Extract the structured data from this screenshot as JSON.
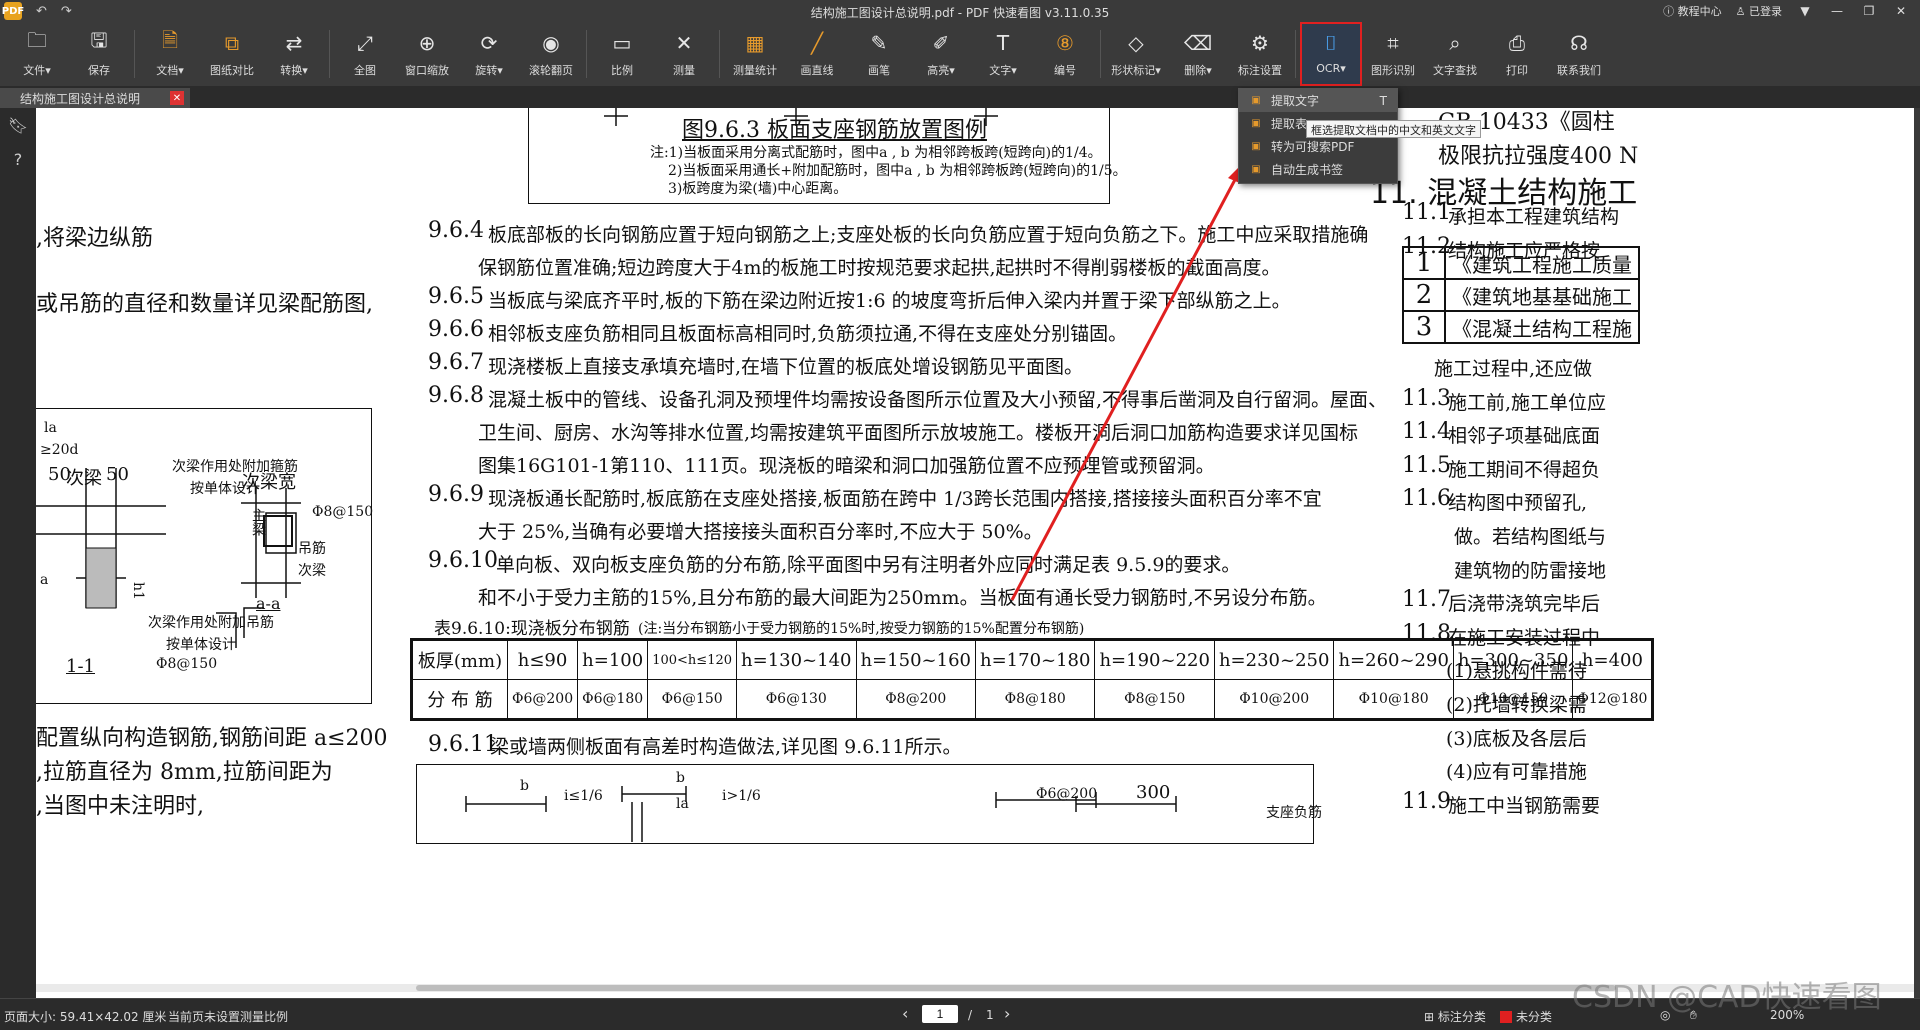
{
  "window": {
    "title": "结构施工图设计总说明.pdf - PDF 快速看图 v3.11.0.35",
    "app_logo": "PDF",
    "help_center": "教程中心",
    "login": "已登录",
    "undo_icon": "undo-icon",
    "redo_icon": "redo-icon"
  },
  "toolbar": {
    "items": [
      {
        "label": "文件▾",
        "icon": "folder-icon",
        "glyph": "🗀"
      },
      {
        "label": "保存",
        "icon": "save-icon",
        "glyph": "🖫"
      },
      {
        "label": "文档▾",
        "icon": "document-icon",
        "glyph": "🗎"
      },
      {
        "label": "图纸对比",
        "icon": "compare-icon",
        "glyph": "⧉"
      },
      {
        "label": "转换▾",
        "icon": "convert-icon",
        "glyph": "⇄"
      },
      {
        "label": "全图",
        "icon": "fit-icon",
        "glyph": "⤢"
      },
      {
        "label": "窗口缩放",
        "icon": "zoom-window-icon",
        "glyph": "⊕"
      },
      {
        "label": "旋转▾",
        "icon": "rotate-icon",
        "glyph": "⟳"
      },
      {
        "label": "滚轮翻页",
        "icon": "mouse-icon",
        "glyph": "◉"
      },
      {
        "label": "比例",
        "icon": "scale-icon",
        "glyph": "▭"
      },
      {
        "label": "测量",
        "icon": "measure-icon",
        "glyph": "✕"
      },
      {
        "label": "测量统计",
        "icon": "measure-stats-icon",
        "glyph": "▦"
      },
      {
        "label": "画直线",
        "icon": "line-icon",
        "glyph": "╱"
      },
      {
        "label": "画笔",
        "icon": "pen-icon",
        "glyph": "✎"
      },
      {
        "label": "高亮▾",
        "icon": "highlight-icon",
        "glyph": "✐"
      },
      {
        "label": "文字▾",
        "icon": "text-icon",
        "glyph": "T"
      },
      {
        "label": "编号",
        "icon": "number-icon",
        "glyph": "⑧"
      },
      {
        "label": "形状标记▾",
        "icon": "shape-mark-icon",
        "glyph": "◇"
      },
      {
        "label": "删除▾",
        "icon": "eraser-icon",
        "glyph": "⌫"
      },
      {
        "label": "标注设置",
        "icon": "annotation-settings-icon",
        "glyph": "⚙"
      },
      {
        "label": "OCR▾",
        "icon": "ocr-icon",
        "glyph": "⌷"
      },
      {
        "label": "图形识别",
        "icon": "shape-recognition-icon",
        "glyph": "⌗"
      },
      {
        "label": "文字查找",
        "icon": "search-icon",
        "glyph": "⌕"
      },
      {
        "label": "打印",
        "icon": "print-icon",
        "glyph": "⎙"
      },
      {
        "label": "联系我们",
        "icon": "headset-icon",
        "glyph": "☊"
      }
    ]
  },
  "tab": {
    "label": "结构施工图设计总说明",
    "close": "✕"
  },
  "ocr_menu": {
    "items": [
      {
        "label": "提取文字",
        "shortcut": "T"
      },
      {
        "label": "提取表",
        "shortcut": ""
      },
      {
        "label": "转为可搜索PDF",
        "shortcut": ""
      },
      {
        "label": "自动生成书签",
        "shortcut": ""
      }
    ],
    "tooltip": "框选提取文档中的中文和英文文字"
  },
  "doc": {
    "fig963_title": "图9.6.3  板面支座钢筋放置图例",
    "fig963_notes": [
      "注:1)当板面采用分离式配筋时，图中a , b 为相邻跨板跨(短跨向)的1/4。",
      "2)当板面采用通长+附加配筋时，图中a , b 为相邻跨板跨(短跨向)的1/5。",
      "3)板跨度为梁(墙)中心距离。"
    ],
    "left_col": [
      ",将梁边纵筋",
      "或吊筋的直径和数量详见梁配筋图,",
      "配置纵向构造钢筋,钢筋间距  a≤200",
      ",拉筋直径为 8mm,拉筋间距为",
      ",当图中未注明时,"
    ],
    "left_fig": {
      "la": "la",
      "ge20d": "≥20d",
      "fifty": "50",
      "ciliang": "次梁",
      "fifty2": "50",
      "note1": "次梁作用处附加箍筋",
      "note1b": "按单体设计",
      "ciliang_kuan": "次梁宽",
      "zhuliang": "主梁",
      "phi8": "Φ8@150",
      "diaojin": "吊筋",
      "ciliang2": "次梁",
      "a": "a",
      "h1": "h1",
      "note2": "次梁作用处附加吊筋",
      "note2b": "按单体设计",
      "aa": "a-a",
      "sec11": "1-1",
      "phi8b": "Φ8@150"
    },
    "paras": [
      {
        "num": "9.6.4",
        "lines": [
          "板底部板的长向钢筋应置于短向钢筋之上;支座处板的长向负筋应置于短向负筋之下。施工中应采取措施确",
          "保钢筋位置准确;短边跨度大于4m的板施工时按规范要求起拱,起拱时不得削弱楼板的截面高度。"
        ]
      },
      {
        "num": "9.6.5",
        "lines": [
          "当板底与梁底齐平时,板的下筋在梁边附近按1:6 的坡度弯折后伸入梁内并置于梁下部纵筋之上。"
        ]
      },
      {
        "num": "9.6.6",
        "lines": [
          "相邻板支座负筋相同且板面标高相同时,负筋须拉通,不得在支座处分别锚固。"
        ]
      },
      {
        "num": "9.6.7",
        "lines": [
          "现浇楼板上直接支承填充墙时,在墙下位置的板底处增设钢筋见平面图。"
        ]
      },
      {
        "num": "9.6.8",
        "lines": [
          "混凝土板中的管线、设备孔洞及预埋件均需按设备图所示位置及大小预留,不得事后凿洞及自行留洞。屋面、",
          "卫生间、厨房、水沟等排水位置,均需按建筑平面图所示放坡施工。楼板开洞后洞口加筋构造要求详见国标",
          "图集16G101-1第110、111页。现浇板的暗梁和洞口加强筋位置不应预埋管或预留洞。"
        ]
      },
      {
        "num": "9.6.9",
        "lines": [
          "现浇板通长配筋时,板底筋在支座处搭接,板面筋在跨中 1/3跨长范围内搭接,搭接接头面积百分率不宜",
          "大于 25%,当确有必要增大搭接接头面积百分率时,不应大于 50%。"
        ]
      },
      {
        "num": "9.6.10",
        "lines": [
          "单向板、双向板支座负筋的分布筋,除平面图中另有注明者外应同时满足表 9.5.9的要求。",
          "和不小于受力主筋的15%,且分布筋的最大间距为250mm。当板面有通长受力钢筋时,不另设分布筋。"
        ]
      }
    ],
    "table_title": "表9.6.10:现浇板分布钢筋",
    "table_note": "(注:当分布钢筋小于受力钢筋的15%时,按受力钢筋的15%配置分布钢筋)",
    "table_header": [
      "板厚(mm)",
      "h≤90",
      "h=100",
      "100<h≤120",
      "h=130~140",
      "h=150~160",
      "h=170~180",
      "h=190~220",
      "h=230~250",
      "h=260~290",
      "h=300~350",
      "h=400"
    ],
    "table_row": [
      "分 布 筋",
      "Φ6@200",
      "Φ6@180",
      "Φ6@150",
      "Φ6@130",
      "Φ8@200",
      "Φ8@180",
      "Φ8@150",
      "Φ10@200",
      "Φ10@180",
      "Φ10@150",
      "Φ12@180"
    ],
    "para_9611": {
      "num": "9.6.11",
      "text": "梁或墙两侧板面有高差时构造做法,详见图 9.6.11所示。"
    },
    "bottom_fig": {
      "b1": "b",
      "i1": "i≤1/6",
      "b2": "b",
      "la": "la",
      "i2": "i>1/6",
      "phi6": "Φ6@200",
      "three_hundred": "300",
      "zhizuo": "支座负筋"
    },
    "right_col": {
      "gb": "GB 10433《圆柱",
      "jixian": "极限抗拉强度400 N",
      "sec11_title": "11. 混凝土结构施工",
      "items": [
        {
          "num": "11.1",
          "text": "承担本工程建筑结构"
        },
        {
          "num": "11.2",
          "text": "结构施工应严格按"
        }
      ],
      "std_list": [
        {
          "n": "1",
          "t": "《建筑工程施工质量"
        },
        {
          "n": "2",
          "t": "《建筑地基基础施工"
        },
        {
          "n": "3",
          "t": "《混凝土结构工程施"
        }
      ],
      "items2": [
        {
          "num": "",
          "text": "施工过程中,还应做"
        },
        {
          "num": "11.3",
          "text": "施工前,施工单位应"
        },
        {
          "num": "11.4",
          "text": "相邻子项基础底面"
        },
        {
          "num": "11.5",
          "text": "施工期间不得超负"
        },
        {
          "num": "11.6",
          "text": "结构图中预留孔,"
        },
        {
          "num": "",
          "text": "做。若结构图纸与"
        },
        {
          "num": "",
          "text": "建筑物的防雷接地"
        },
        {
          "num": "11.7",
          "text": "后浇带浇筑完毕后"
        },
        {
          "num": "11.8",
          "text": "在施工安装过程中"
        },
        {
          "num": "",
          "text": "(1)悬挑构件需待"
        },
        {
          "num": "",
          "text": "(2)托墙转换梁需"
        },
        {
          "num": "",
          "text": "(3)底板及各层后"
        },
        {
          "num": "",
          "text": "(4)应有可靠措施"
        },
        {
          "num": "11.9",
          "text": "施工中当钢筋需要"
        }
      ]
    }
  },
  "status": {
    "page_size": "页面大小: 59.41×42.02 厘米",
    "scale": "当前页未设置测量比例",
    "page_current": "1",
    "page_sep": "/",
    "page_total": "1",
    "prev": "‹",
    "next": "›",
    "annot_class": "标注分类",
    "uncategorized": "未分类",
    "zoom": "200%",
    "watermark": "CSDN @CAD快速看图"
  },
  "colors": {
    "accent": "#e02020",
    "toolbar_bg": "#3a3a3a",
    "ocr_blue": "#4a9ee8",
    "orange": "#e69a2c"
  }
}
